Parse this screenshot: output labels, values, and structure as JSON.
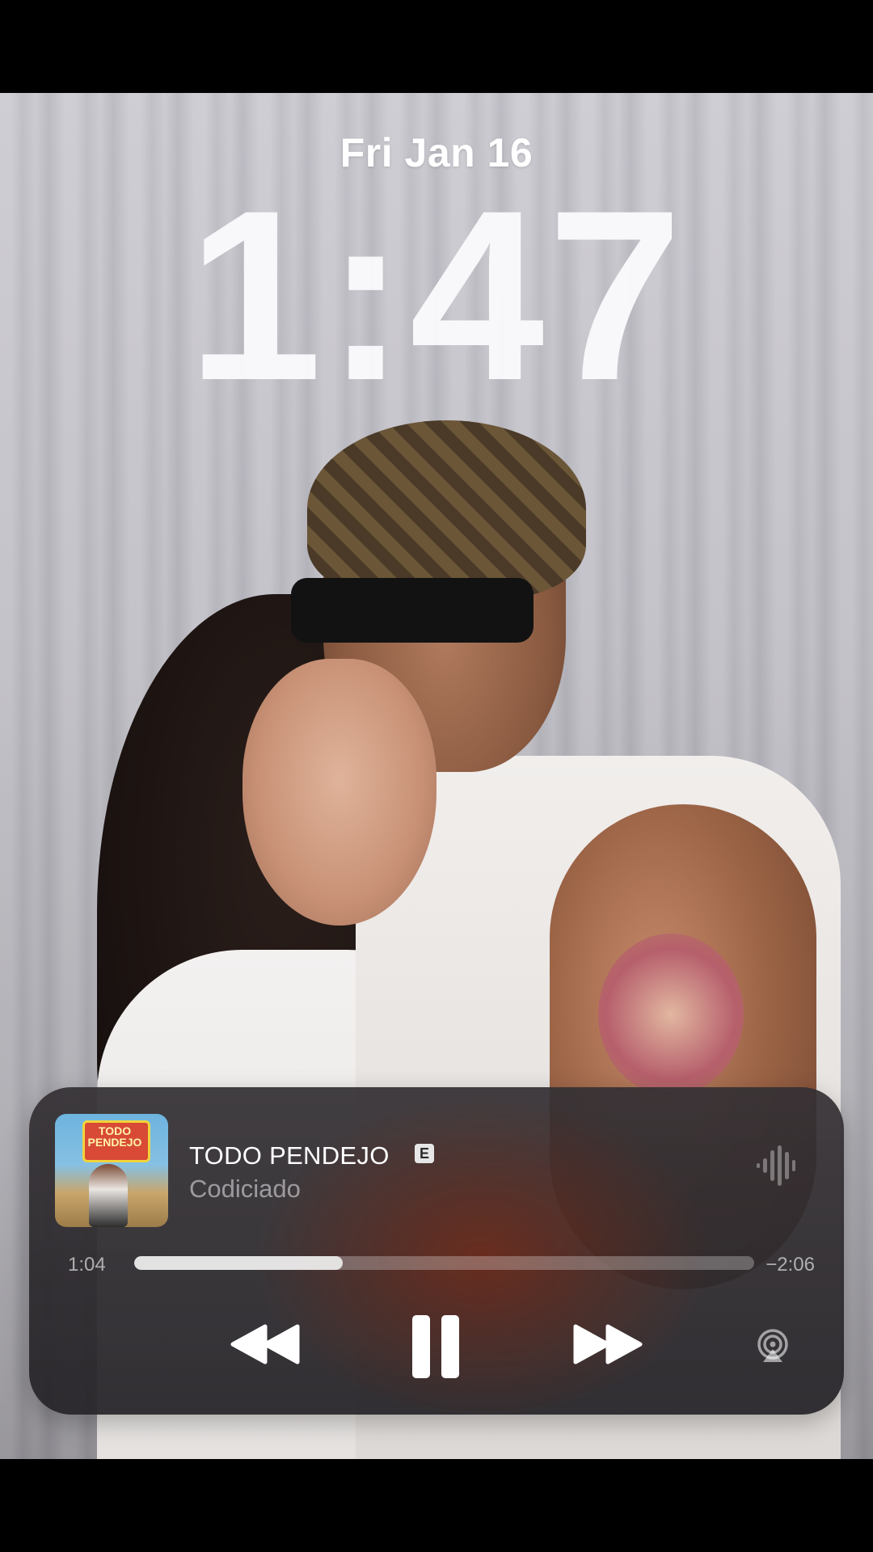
{
  "lock_screen": {
    "date": "Fri Jan 16",
    "time": "1:47"
  },
  "now_playing": {
    "artwork_text": "TODO PENDEJO",
    "title": "TODO PENDEJO",
    "explicit_badge": "E",
    "artist": "Codiciado",
    "elapsed": "1:04",
    "remaining": "−2:06",
    "progress": 0.337,
    "icons": {
      "waveform": "waveform-icon",
      "rewind": "rewind-icon",
      "pause": "pause-icon",
      "forward": "fast-forward-icon",
      "airplay": "airplay-icon"
    }
  },
  "colors": {
    "player_background": "#2f2c30",
    "accent_glow": "#7a2a16",
    "text_primary": "#ffffff"
  }
}
